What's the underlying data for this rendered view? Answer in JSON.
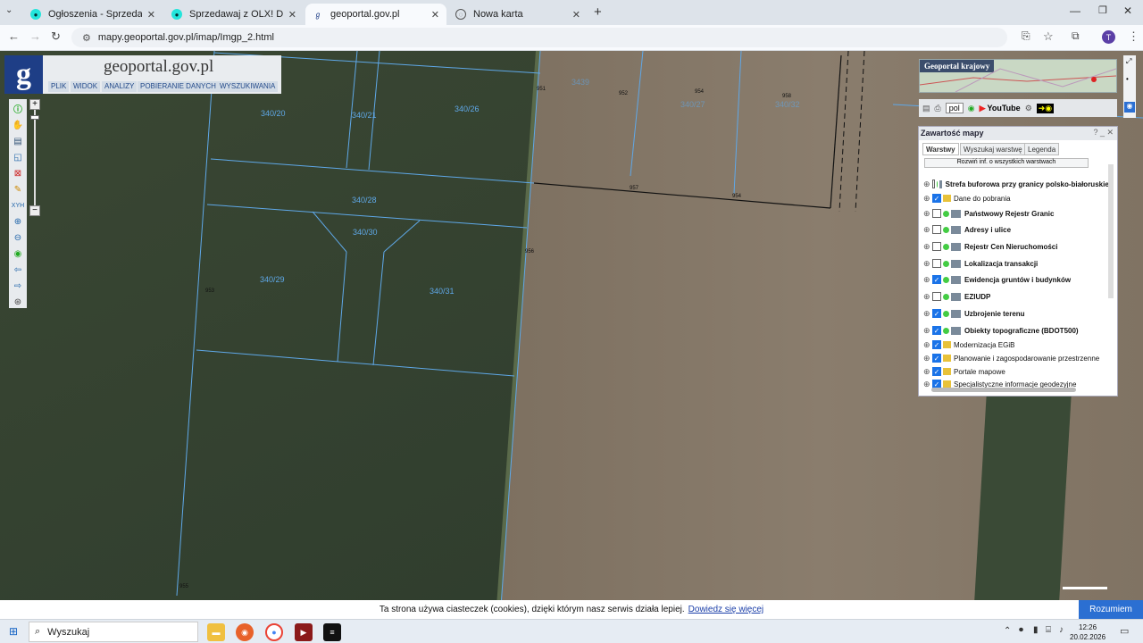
{
  "browser": {
    "tabs": [
      {
        "title": "Ogłoszenia - Sprzedam, kupię na OLX",
        "favicon": "olx-icon"
      },
      {
        "title": "Sprzedawaj z OLX! Dodaj ofertę",
        "favicon": "olx-icon"
      },
      {
        "title": "geoportal.gov.pl",
        "favicon": "geoportal-icon",
        "active": true
      },
      {
        "title": "Nowa karta",
        "favicon": "globe-icon"
      }
    ],
    "url": "mapy.geoportal.gov.pl/imap/Imgp_2.html",
    "profile_initial": "T"
  },
  "app": {
    "logo_letter": "g",
    "brand": "geoportal.gov.pl",
    "menu": [
      "PLIK",
      "WIDOK",
      "ANALIZY",
      "POBIERANIE DANYCH",
      "WYSZUKIWANIA"
    ]
  },
  "map": {
    "parcels": [
      "340/20",
      "340/21",
      "340/26",
      "340/28",
      "340/30",
      "340/29",
      "340/31",
      "3439",
      "340/27",
      "340/32"
    ],
    "points": [
      "951",
      "952",
      "954",
      "958",
      "953",
      "956",
      "957",
      "954",
      "955"
    ]
  },
  "overview": {
    "title": "Geoportal krajowy",
    "lang": "pol",
    "youtube": "YouTube"
  },
  "layers": {
    "title": "Zawartość mapy",
    "tabs": [
      "Warstwy",
      "Wyszukaj warstwę",
      "Legenda"
    ],
    "expand_all": "Rozwiń inf. o wszystkich warstwach",
    "items": [
      {
        "label": "Strefa buforowa przy granicy polsko-białoruskiej",
        "checked": false,
        "bold": true,
        "kind": "layer"
      },
      {
        "label": "Dane do pobrania",
        "checked": true,
        "bold": false,
        "kind": "folder"
      },
      {
        "label": "Państwowy Rejestr Granic",
        "checked": false,
        "bold": true,
        "kind": "layer"
      },
      {
        "label": "Adresy i ulice",
        "checked": false,
        "bold": true,
        "kind": "layer"
      },
      {
        "label": "Rejestr Cen Nieruchomości",
        "checked": false,
        "bold": true,
        "kind": "layer"
      },
      {
        "label": "Lokalizacja transakcji",
        "checked": false,
        "bold": true,
        "kind": "layer"
      },
      {
        "label": "Ewidencja gruntów i budynków",
        "checked": true,
        "bold": true,
        "kind": "layer"
      },
      {
        "label": "EZIUDP",
        "checked": false,
        "bold": true,
        "kind": "layer"
      },
      {
        "label": "Uzbrojenie terenu",
        "checked": true,
        "bold": true,
        "kind": "layer"
      },
      {
        "label": "Obiekty topograficzne (BDOT500)",
        "checked": true,
        "bold": true,
        "kind": "layer"
      },
      {
        "label": "Modernizacja EGiB",
        "checked": true,
        "bold": false,
        "kind": "folder"
      },
      {
        "label": "Planowanie i zagospodarowanie przestrzenne",
        "checked": true,
        "bold": false,
        "kind": "folder"
      },
      {
        "label": "Portale mapowe",
        "checked": true,
        "bold": false,
        "kind": "folder"
      },
      {
        "label": "Specjalistyczne informacje geodezyjne",
        "checked": true,
        "bold": false,
        "kind": "folder"
      }
    ]
  },
  "cookie": {
    "text": "Ta strona używa ciasteczek (cookies), dzięki którym nasz serwis działa lepiej.",
    "link": "Dowiedz się więcej",
    "button": "Rozumiem"
  },
  "taskbar": {
    "search_placeholder": "Wyszukaj",
    "time": "12:26",
    "date": "20.02.2026"
  },
  "colors": {
    "accent": "#2b6fd2",
    "parcel_line": "#5fa8e8",
    "brand_blue": "#1e3e86"
  }
}
